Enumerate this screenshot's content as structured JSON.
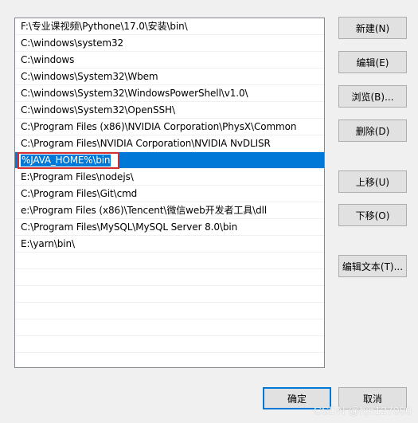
{
  "path_list": {
    "items": [
      "F:\\专业课视频\\Pythone\\17.0\\安装\\bin\\",
      "C:\\windows\\system32",
      "C:\\windows",
      "C:\\windows\\System32\\Wbem",
      "C:\\windows\\System32\\WindowsPowerShell\\v1.0\\",
      "C:\\windows\\System32\\OpenSSH\\",
      "C:\\Program Files (x86)\\NVIDIA Corporation\\PhysX\\Common",
      "C:\\Program Files\\NVIDIA Corporation\\NVIDIA NvDLISR",
      "%JAVA_HOME%\\bin",
      "E:\\Program Files\\nodejs\\",
      "C:\\Program Files\\Git\\cmd",
      "e:\\Program Files (x86)\\Tencent\\微信web开发者工具\\dll",
      "C:\\Program Files\\MySQL\\MySQL Server 8.0\\bin",
      "E:\\yarn\\bin\\"
    ],
    "selected_index": 8,
    "editing_value": "%JAVA_HOME%\\bin"
  },
  "buttons": {
    "new": "新建(N)",
    "edit": "编辑(E)",
    "browse": "浏览(B)...",
    "delete": "删除(D)",
    "move_up": "上移(U)",
    "move_down": "下移(O)",
    "edit_text": "编辑文本(T)...",
    "ok": "确定",
    "cancel": "取消"
  },
  "watermark": "CSDN @hjn127000",
  "colors": {
    "selection": "#0078d7",
    "edit_highlight_border": "#d42e2e",
    "window_background": "#f0f0f0"
  }
}
